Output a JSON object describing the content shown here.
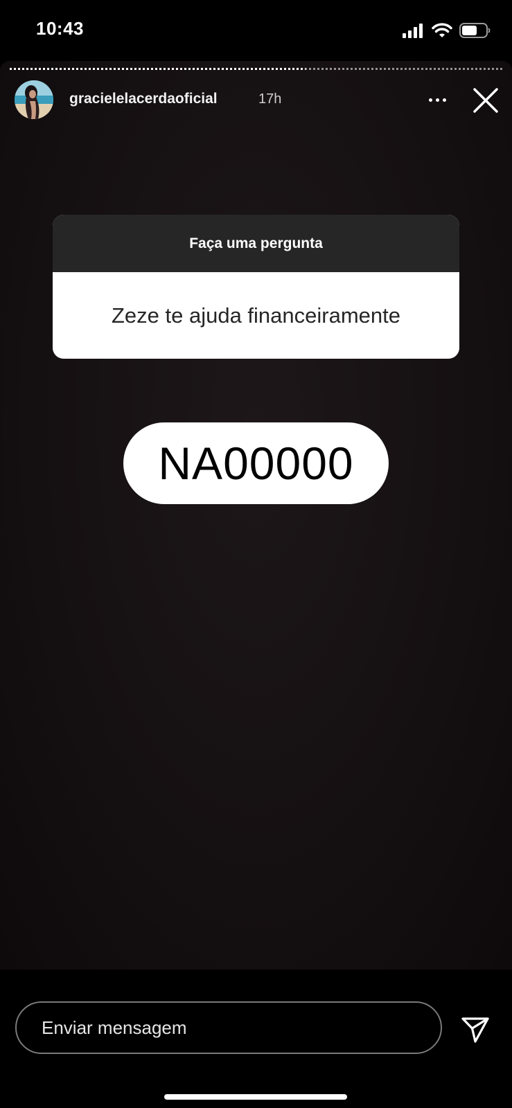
{
  "status_bar": {
    "time": "10:43",
    "icons": [
      "signal-icon",
      "wifi-icon",
      "battery-icon"
    ]
  },
  "story": {
    "progress": 0.6,
    "username": "gracielelacerdaoficial",
    "time_ago": "17h",
    "icons": [
      "more-options-icon",
      "close-icon"
    ]
  },
  "question_sticker": {
    "header": "Faça uma pergunta",
    "question": "Zeze te ajuda financeiramente"
  },
  "answer": {
    "text": "NA00000"
  },
  "reply_bar": {
    "placeholder": "Enviar mensagem",
    "send_icon": "send-icon"
  },
  "colors": {
    "background": "#000000",
    "story_background": "#151012",
    "sticker_header": "#262626",
    "sticker_body": "#ffffff"
  }
}
